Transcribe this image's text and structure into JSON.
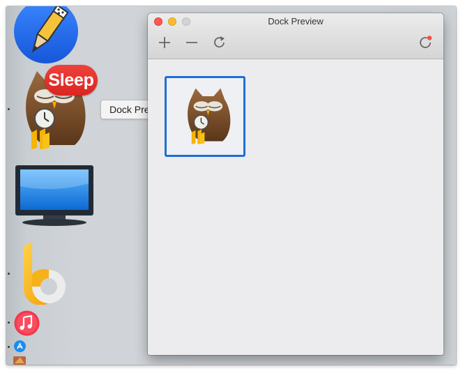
{
  "window": {
    "title": "Dock Preview"
  },
  "dock": {
    "tooltip": "Dock Preview",
    "badge": "Sleep",
    "apps": [
      "notes-app-icon",
      "owl-app-icon",
      "tv-app-icon",
      "b-app-icon",
      "music-app-icon",
      "app-store-icon"
    ]
  },
  "toolbar": {
    "items": [
      "plus-icon",
      "minus-icon",
      "refresh-icon",
      "status-refresh-icon"
    ],
    "status_dot_color": "#f54c47"
  },
  "colors": {
    "selection_border": "#1d6fd6",
    "badge": "#e8322d"
  }
}
